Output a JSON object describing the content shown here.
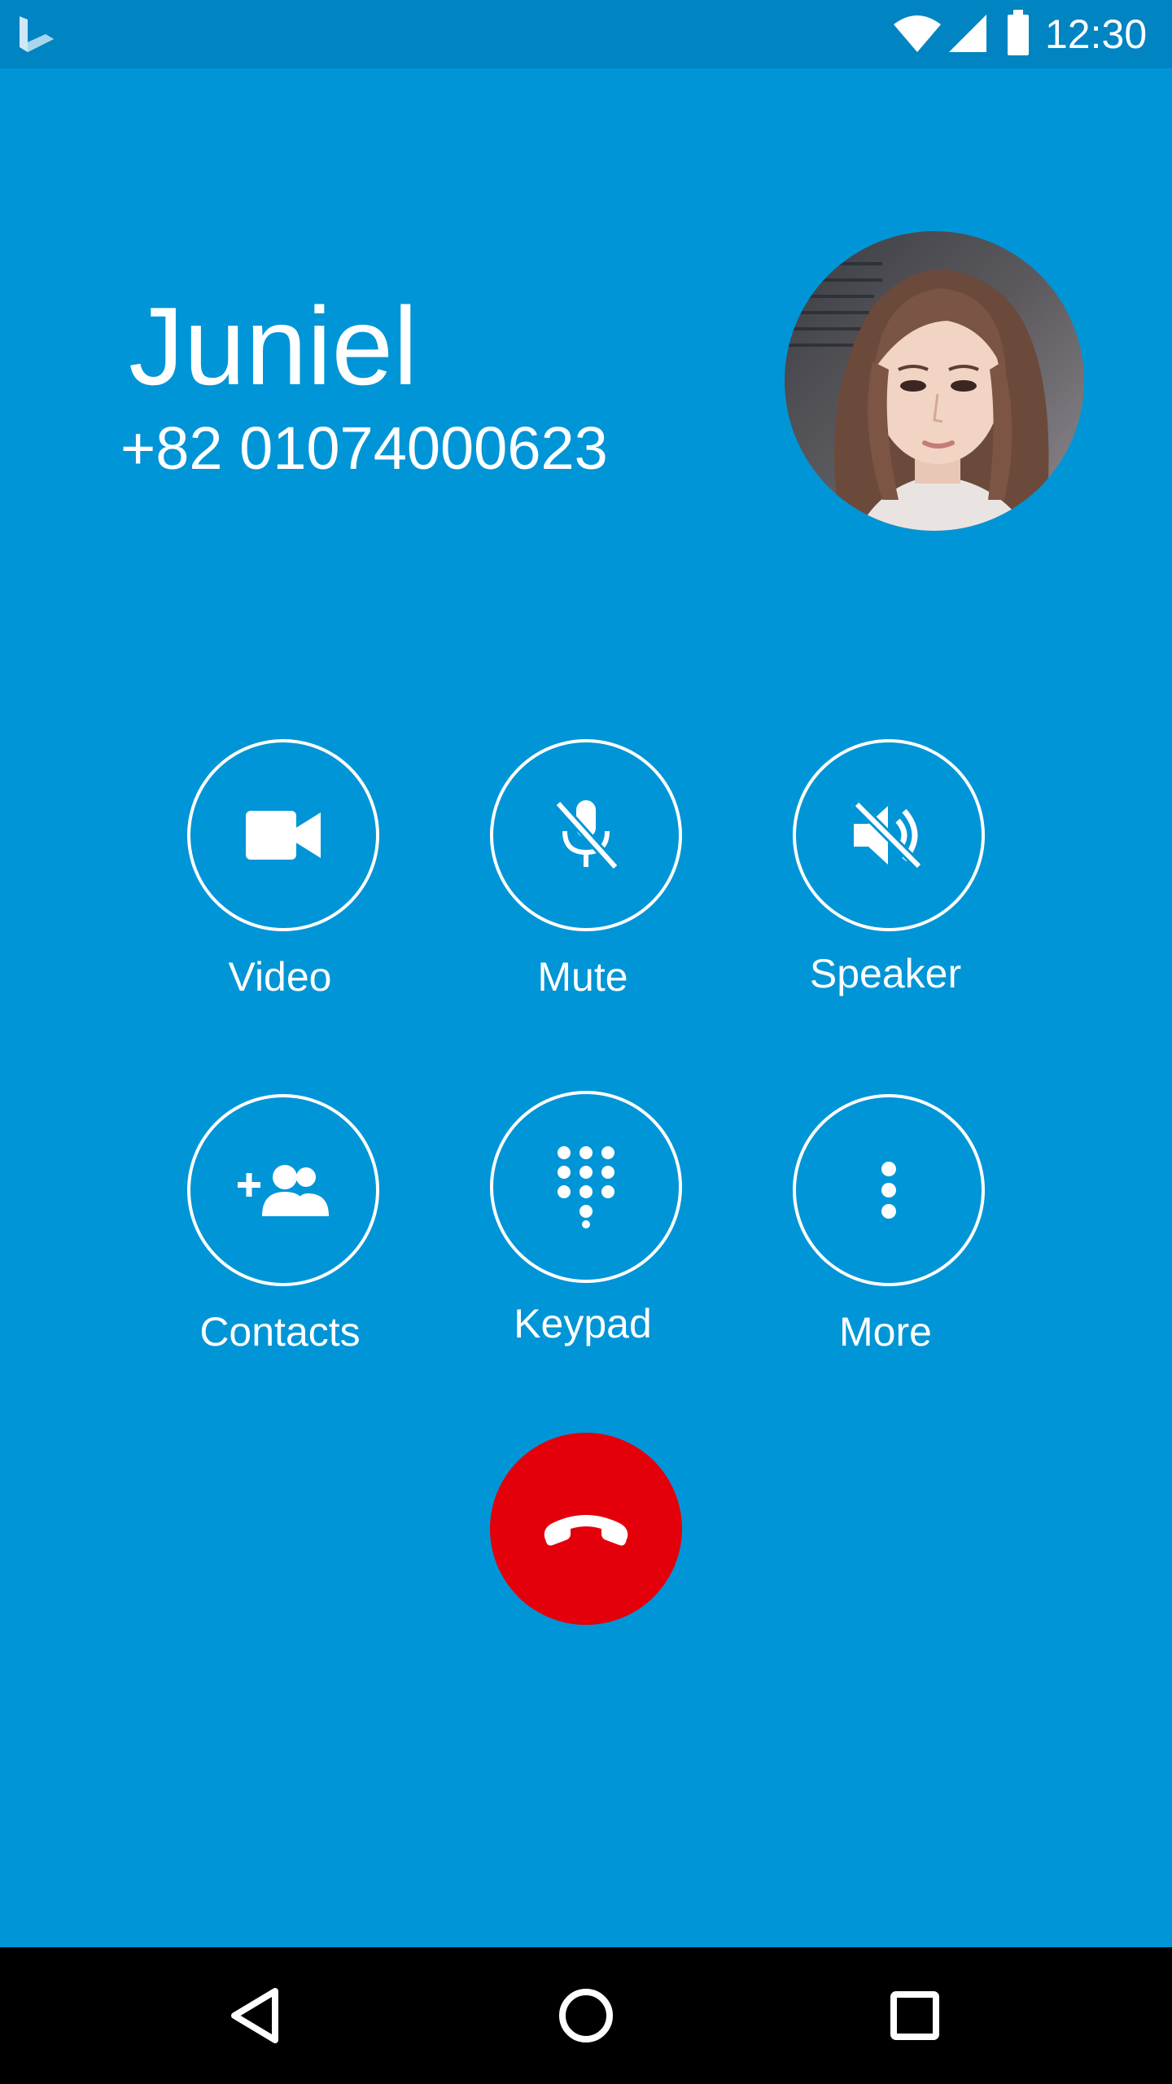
{
  "status_bar": {
    "time": "12:30",
    "icons": [
      "bing-logo-icon",
      "wifi-icon",
      "cell-signal-icon",
      "battery-icon"
    ]
  },
  "caller": {
    "name": "Juniel",
    "number": "+82 01074000623"
  },
  "actions": [
    {
      "id": "video",
      "label": "Video",
      "icon": "video-camera-icon"
    },
    {
      "id": "mute",
      "label": "Mute",
      "icon": "microphone-off-icon"
    },
    {
      "id": "speaker",
      "label": "Speaker",
      "icon": "speaker-off-icon"
    },
    {
      "id": "contacts",
      "label": "Contacts",
      "icon": "add-contacts-icon"
    },
    {
      "id": "keypad",
      "label": "Keypad",
      "icon": "dialpad-icon"
    },
    {
      "id": "more",
      "label": "More",
      "icon": "more-vertical-icon"
    }
  ],
  "end_call": {
    "icon": "hang-up-icon"
  },
  "navigation": {
    "icons": [
      "back-icon",
      "home-icon",
      "recent-apps-icon"
    ]
  },
  "colors": {
    "background": "#0095d6",
    "status_bar": "#0084c2",
    "end_call": "#e3000b",
    "nav_bar": "#000000",
    "foreground": "#ffffff"
  }
}
